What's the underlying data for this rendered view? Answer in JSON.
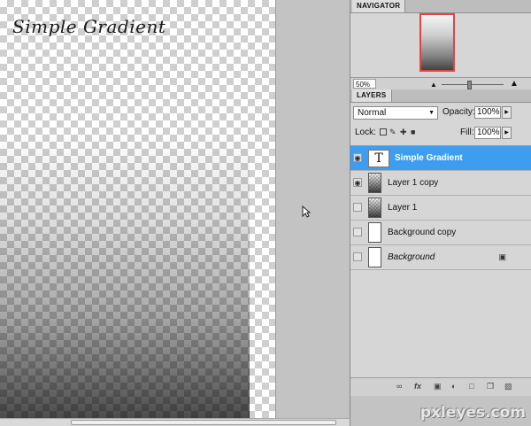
{
  "canvas": {
    "title_text": "Simple Gradient"
  },
  "navigator": {
    "tab_label": "NAVIGATOR",
    "zoom": "50%"
  },
  "layers_panel": {
    "tab_label": "LAYERS",
    "blend_mode": "Normal",
    "opacity_label": "Opacity:",
    "opacity_value": "100%",
    "lock_label": "Lock:",
    "fill_label": "Fill:",
    "fill_value": "100%",
    "layers": [
      {
        "name": "Simple Gradient",
        "visible": true,
        "selected": true,
        "thumb": "text"
      },
      {
        "name": "Layer 1 copy",
        "visible": true,
        "selected": false,
        "thumb": "gradient"
      },
      {
        "name": "Layer 1",
        "visible": false,
        "selected": false,
        "thumb": "gradient"
      },
      {
        "name": "Background copy",
        "visible": false,
        "selected": false,
        "thumb": "white"
      },
      {
        "name": "Background",
        "visible": false,
        "selected": false,
        "thumb": "white",
        "locked": true
      }
    ],
    "footer_icons": [
      "link-icon",
      "fx-icon",
      "mask-icon",
      "adjustment-icon",
      "folder-icon",
      "new-layer-icon",
      "trash-icon"
    ]
  },
  "watermark": "pxleyes.com",
  "colors": {
    "selected_row": "#3d9ef0",
    "navigator_box": "#e04545"
  }
}
